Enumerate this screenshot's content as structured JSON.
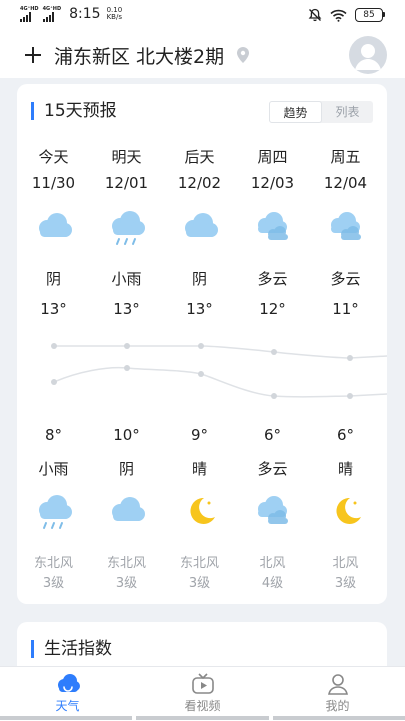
{
  "status_bar": {
    "sim1": "4G⁺HD",
    "sim2": "4G⁺HD",
    "time": "8:15",
    "speed_value": "0.10",
    "speed_unit": "KB/s",
    "battery": "85"
  },
  "header": {
    "location": "浦东新区 北大楼2期"
  },
  "forecast": {
    "title": "15天预报",
    "toggle": [
      "趋势",
      "列表"
    ],
    "days": [
      {
        "day": "今天",
        "date": "11/30",
        "day_weather": "阴",
        "high": "13°",
        "low": "8°",
        "night_weather": "小雨",
        "wind_dir": "东北风",
        "wind_level": "3级",
        "day_icon": "cloud-icon",
        "night_icon": "rain-icon"
      },
      {
        "day": "明天",
        "date": "12/01",
        "day_weather": "小雨",
        "high": "13°",
        "low": "10°",
        "night_weather": "阴",
        "wind_dir": "东北风",
        "wind_level": "3级",
        "day_icon": "rain-icon",
        "night_icon": "cloud-icon"
      },
      {
        "day": "后天",
        "date": "12/02",
        "day_weather": "阴",
        "high": "13°",
        "low": "9°",
        "night_weather": "晴",
        "wind_dir": "东北风",
        "wind_level": "3级",
        "day_icon": "cloud-icon",
        "night_icon": "moon-icon"
      },
      {
        "day": "周四",
        "date": "12/03",
        "day_weather": "多云",
        "high": "12°",
        "low": "6°",
        "night_weather": "多云",
        "wind_dir": "北风",
        "wind_level": "4级",
        "day_icon": "partly-cloudy-icon",
        "night_icon": "partly-cloudy-icon"
      },
      {
        "day": "周五",
        "date": "12/04",
        "day_weather": "多云",
        "high": "11°",
        "low": "6°",
        "night_weather": "晴",
        "wind_dir": "北风",
        "wind_level": "3级",
        "day_icon": "partly-cloudy-icon",
        "night_icon": "moon-icon"
      }
    ]
  },
  "life_index": {
    "title": "生活指数"
  },
  "tabs": [
    {
      "label": "天气",
      "icon": "weather-icon",
      "active": true
    },
    {
      "label": "看视频",
      "icon": "video-icon",
      "active": false
    },
    {
      "label": "我的",
      "icon": "profile-icon",
      "active": false
    }
  ],
  "colors": {
    "accent": "#2e7dfc",
    "cloud": "#9fd0f3",
    "sun": "#f7c51d"
  }
}
